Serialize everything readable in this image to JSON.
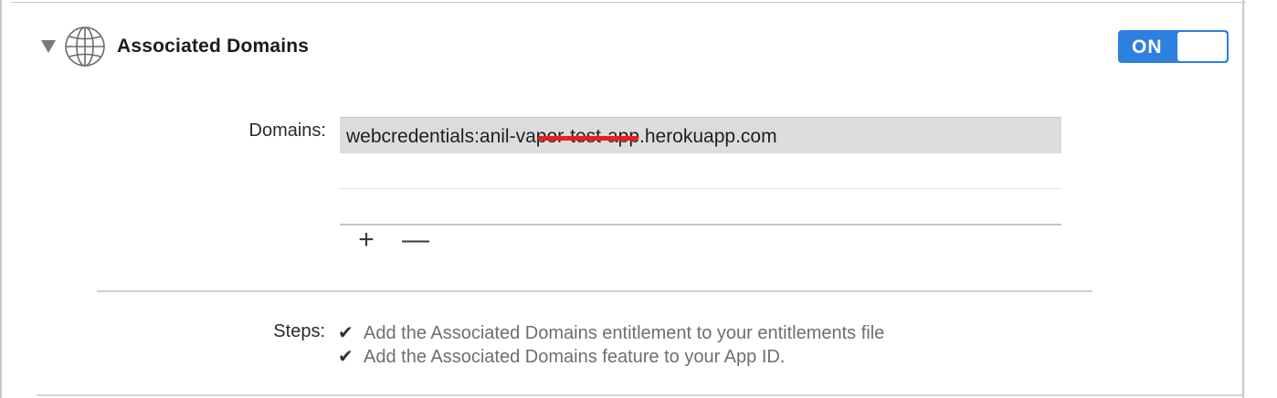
{
  "section": {
    "title": "Associated Domains",
    "toggle_label": "ON",
    "toggle_state": "on",
    "accent_color": "#2d7fe0"
  },
  "domains": {
    "label": "Domains:",
    "entries": [
      "webcredentials:anil-vapor-test-app.herokuapp.com"
    ],
    "add_symbol": "+",
    "remove_symbol": "—"
  },
  "steps": {
    "label": "Steps:",
    "check_symbol": "✔",
    "items": [
      "Add the Associated Domains entitlement to your entitlements file",
      "Add the Associated Domains feature to your App ID."
    ]
  },
  "icons": {
    "disclosure": "disclosure-triangle-down-icon",
    "globe": "globe-icon",
    "redaction_color": "#ee1c1c"
  }
}
